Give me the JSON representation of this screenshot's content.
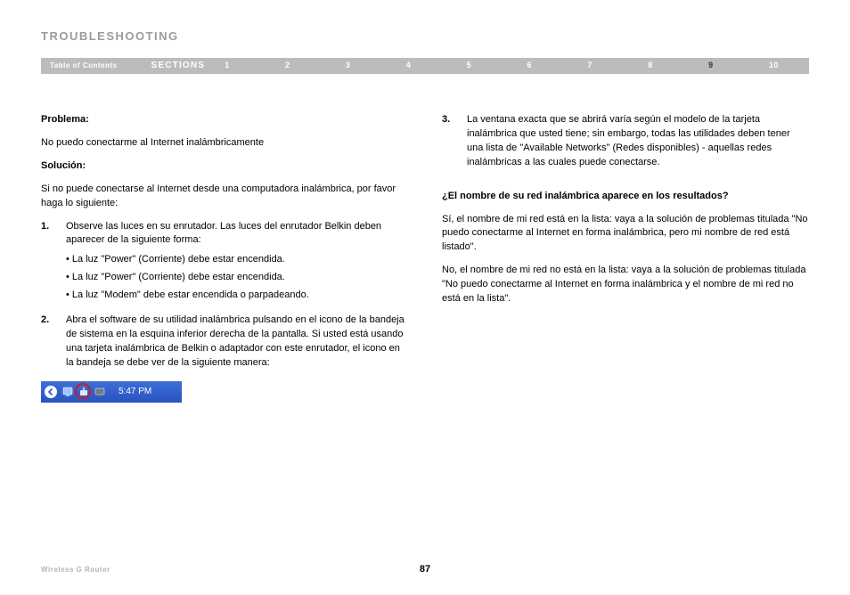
{
  "heading": "TROUBLESHOOTING",
  "nav": {
    "toc": "Table of Contents",
    "sections": "SECTIONS",
    "numbers": [
      "1",
      "2",
      "3",
      "4",
      "5",
      "6",
      "7",
      "8",
      "9",
      "10"
    ],
    "active_index": 8
  },
  "left": {
    "problema_label": "Problema:",
    "problema_text": "No puedo conectarme al Internet inalámbricamente",
    "solucion_label": "Solución:",
    "solucion_intro": "Si no puede conectarse al Internet desde una computadora inalámbrica, por favor haga lo siguiente:",
    "step1": "Observe las luces en su enrutador. Las luces del enrutador Belkin deben aparecer de la siguiente forma:",
    "bullets": [
      "La luz \"Power\" (Corriente) debe estar encendida.",
      "La luz \"Power\" (Corriente) debe estar encendida.",
      "La luz \"Modem\" debe estar encendida o parpadeando."
    ],
    "step2": "Abra el software de su utilidad inalámbrica pulsando en el icono de la bandeja de sistema en la esquina inferior derecha de la pantalla. Si usted está usando una tarjeta inalámbrica de Belkin o adaptador con este enrutador, el icono en la bandeja se debe ver de la siguiente manera:",
    "tray_time": "5:47 PM"
  },
  "right": {
    "step3_num": "3.",
    "step3": "La ventana exacta que se abrirá varía según el modelo de la tarjeta inalámbrica que usted tiene; sin embargo, todas las utilidades deben tener una lista de \"Available Networks\" (Redes disponibles) - aquellas redes inalámbricas a las cuales puede conectarse.",
    "question": "¿El nombre de su red inalámbrica aparece en los resultados?",
    "yes_text": "Sí, el nombre de mi red está en la lista: vaya a la solución de problemas titulada \"No puedo conectarme al Internet en forma inalámbrica, pero mi nombre de red está listado\".",
    "no_text": "No, el nombre de mi red no está en la lista: vaya a la solución de problemas titulada \"No puedo conectarme al Internet en forma inalámbrica y el nombre de mi red no está en la lista\"."
  },
  "footer": {
    "title": "Wireless G Router",
    "page_number": "87"
  }
}
